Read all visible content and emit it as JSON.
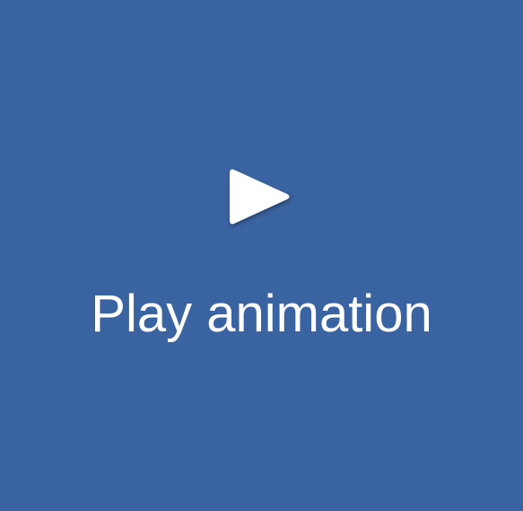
{
  "player": {
    "icon": "play-icon",
    "label": "Play animation",
    "background_color": "#3a63a1",
    "icon_color": "#ffffff"
  }
}
